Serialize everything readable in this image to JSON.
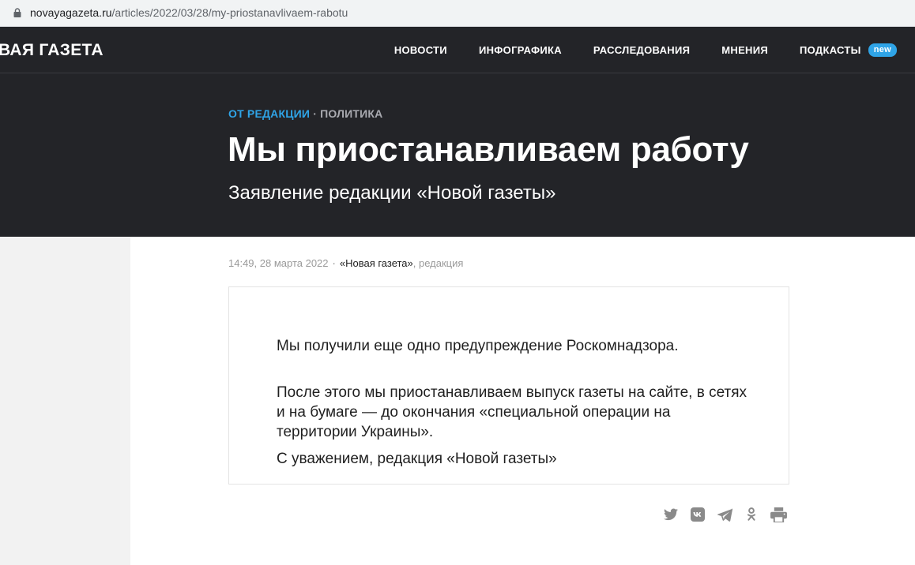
{
  "browser": {
    "url_domain": "novayagazeta.ru",
    "url_path": "/articles/2022/03/28/my-priostanavlivaem-rabotu"
  },
  "header": {
    "logo": "ВАЯ ГАЗЕТА",
    "nav": [
      {
        "label": "НОВОСТИ"
      },
      {
        "label": "ИНФОГРАФИКА"
      },
      {
        "label": "РАССЛЕДОВАНИЯ"
      },
      {
        "label": "МНЕНИЯ"
      },
      {
        "label": "ПОДКАСТЫ",
        "badge": "new"
      }
    ]
  },
  "article": {
    "rubric_main": "ОТ РЕДАКЦИИ",
    "rubric_sep": "·",
    "rubric_sub": "ПОЛИТИКА",
    "title": "Мы приостанавливаем работу",
    "subtitle": "Заявление редакции «Новой газеты»",
    "meta": {
      "time": "14:49, 28 марта 2022",
      "dot": "·",
      "author": "«Новая газета»",
      "role": ", редакция"
    },
    "statement": [
      "Мы получили еще одно предупреждение Роскомнадзора.",
      "После этого мы приостанавливаем выпуск газеты на сайте, в сетях и на бумаге — до окончания «специальной операции на территории Украины».",
      "С уважением, редакция «Новой газеты»"
    ]
  },
  "share": {
    "icons": [
      "twitter-icon",
      "vk-icon",
      "telegram-icon",
      "odnoklassniki-icon",
      "print-icon"
    ],
    "icon_color": "#8a8a8a"
  },
  "colors": {
    "header_bg": "#232428",
    "accent": "#2fa4e7",
    "muted": "#a9aab0"
  }
}
